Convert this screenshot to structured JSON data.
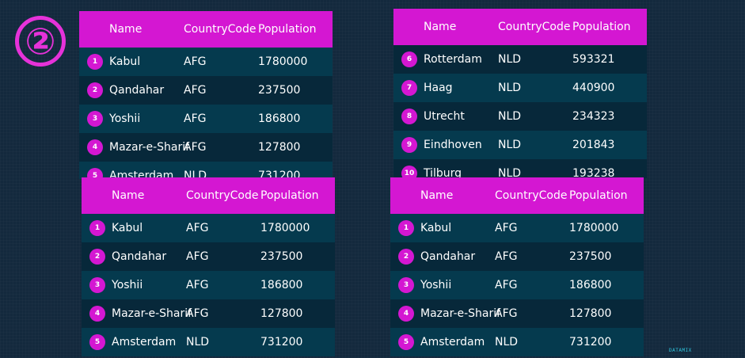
{
  "step_marker": "②",
  "logo_text": "DATAMIX",
  "tables": [
    {
      "id": "top-left",
      "headers": [
        "Name",
        "CountryCode",
        "Population"
      ],
      "rows": [
        {
          "num": "1",
          "name": "Kabul",
          "code": "AFG",
          "pop": "1780000"
        },
        {
          "num": "2",
          "name": "Qandahar",
          "code": "AFG",
          "pop": "237500"
        },
        {
          "num": "3",
          "name": "Yoshii",
          "code": "AFG",
          "pop": "186800"
        },
        {
          "num": "4",
          "name": "Mazar-e-Sharif",
          "code": "AFG",
          "pop": "127800"
        },
        {
          "num": "5",
          "name": "Amsterdam",
          "code": "NLD",
          "pop": "731200"
        }
      ]
    },
    {
      "id": "top-right",
      "headers": [
        "Name",
        "CountryCode",
        "Population"
      ],
      "rows": [
        {
          "num": "6",
          "name": "Rotterdam",
          "code": "NLD",
          "pop": "593321"
        },
        {
          "num": "7",
          "name": "Haag",
          "code": "NLD",
          "pop": "440900"
        },
        {
          "num": "8",
          "name": "Utrecht",
          "code": "NLD",
          "pop": "234323"
        },
        {
          "num": "9",
          "name": "Eindhoven",
          "code": "NLD",
          "pop": "201843"
        },
        {
          "num": "10",
          "name": "Tilburg",
          "code": "NLD",
          "pop": "193238"
        }
      ]
    },
    {
      "id": "bottom-left",
      "headers": [
        "Name",
        "CountryCode",
        "Population"
      ],
      "rows": [
        {
          "num": "1",
          "name": "Kabul",
          "code": "AFG",
          "pop": "1780000"
        },
        {
          "num": "2",
          "name": "Qandahar",
          "code": "AFG",
          "pop": "237500"
        },
        {
          "num": "3",
          "name": "Yoshii",
          "code": "AFG",
          "pop": "186800"
        },
        {
          "num": "4",
          "name": "Mazar-e-Sharif",
          "code": "AFG",
          "pop": "127800"
        },
        {
          "num": "5",
          "name": "Amsterdam",
          "code": "NLD",
          "pop": "731200"
        }
      ]
    },
    {
      "id": "bottom-right",
      "headers": [
        "Name",
        "CountryCode",
        "Population"
      ],
      "rows": [
        {
          "num": "1",
          "name": "Kabul",
          "code": "AFG",
          "pop": "1780000"
        },
        {
          "num": "2",
          "name": "Qandahar",
          "code": "AFG",
          "pop": "237500"
        },
        {
          "num": "3",
          "name": "Yoshii",
          "code": "AFG",
          "pop": "186800"
        },
        {
          "num": "4",
          "name": "Mazar-e-Sharif",
          "code": "AFG",
          "pop": "127800"
        },
        {
          "num": "5",
          "name": "Amsterdam",
          "code": "NLD",
          "pop": "731200"
        }
      ]
    }
  ]
}
